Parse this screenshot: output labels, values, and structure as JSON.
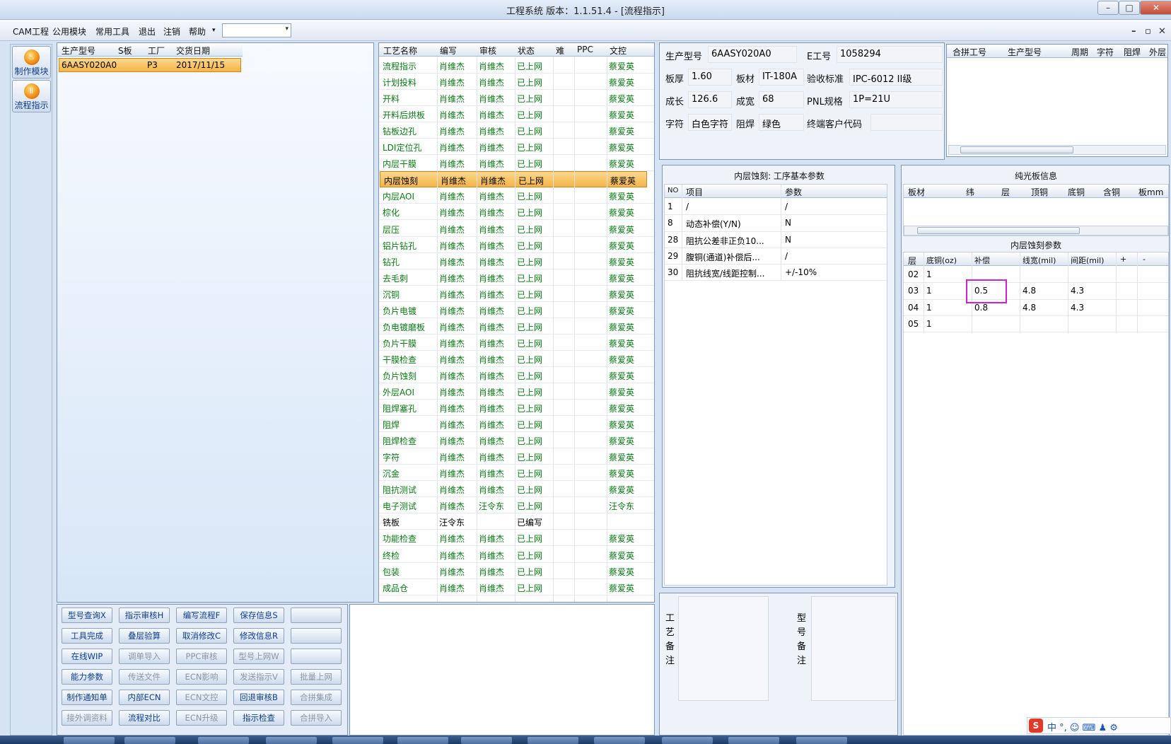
{
  "window": {
    "title": "工程系统  版本：1.1.51.4 - [流程指示]",
    "min": "–",
    "max": "□",
    "close": "✕"
  },
  "menu": {
    "items": [
      "CAM工程",
      "公用模块",
      "常用工具",
      "退出",
      "注销",
      "帮助"
    ],
    "help_arrow": "▾",
    "combo_arrow": "▾",
    "mdi": [
      "–",
      "▫",
      "✕"
    ]
  },
  "sidebar": {
    "buttons": [
      {
        "label": "制作模块",
        "icon": "flame-icon"
      },
      {
        "label": "流程指示",
        "icon": "pause-icon"
      }
    ]
  },
  "orders": {
    "columns": [
      "生产型号",
      "S板",
      "工厂",
      "交货日期"
    ],
    "rows": [
      {
        "model": "6AASY020A0",
        "s": "",
        "factory": "P3",
        "date": "2017/11/15"
      }
    ]
  },
  "process": {
    "columns": [
      "工艺名称",
      "编写",
      "审核",
      "状态",
      "难",
      "PPC",
      "文控"
    ],
    "rows": [
      [
        "流程指示",
        "肖维杰",
        "肖维杰",
        "已上网",
        "",
        "",
        "蔡爱英"
      ],
      [
        "计划投料",
        "肖维杰",
        "肖维杰",
        "已上网",
        "",
        "",
        "蔡爱英"
      ],
      [
        "开料",
        "肖维杰",
        "肖维杰",
        "已上网",
        "",
        "",
        "蔡爱英"
      ],
      [
        "开料后烘板",
        "肖维杰",
        "肖维杰",
        "已上网",
        "",
        "",
        "蔡爱英"
      ],
      [
        "钻板边孔",
        "肖维杰",
        "肖维杰",
        "已上网",
        "",
        "",
        "蔡爱英"
      ],
      [
        "LDI定位孔",
        "肖维杰",
        "肖维杰",
        "已上网",
        "",
        "",
        "蔡爱英"
      ],
      [
        "内层干膜",
        "肖维杰",
        "肖维杰",
        "已上网",
        "",
        "",
        "蔡爱英"
      ],
      [
        "内层蚀刻",
        "肖维杰",
        "肖维杰",
        "已上网",
        "",
        "",
        "蔡爱英"
      ],
      [
        "内层AOI",
        "肖维杰",
        "肖维杰",
        "已上网",
        "",
        "",
        "蔡爱英"
      ],
      [
        "棕化",
        "肖维杰",
        "肖维杰",
        "已上网",
        "",
        "",
        "蔡爱英"
      ],
      [
        "层压",
        "肖维杰",
        "肖维杰",
        "已上网",
        "",
        "",
        "蔡爱英"
      ],
      [
        "铝片钻孔",
        "肖维杰",
        "肖维杰",
        "已上网",
        "",
        "",
        "蔡爱英"
      ],
      [
        "钻孔",
        "肖维杰",
        "肖维杰",
        "已上网",
        "",
        "",
        "蔡爱英"
      ],
      [
        "去毛刺",
        "肖维杰",
        "肖维杰",
        "已上网",
        "",
        "",
        "蔡爱英"
      ],
      [
        "沉铜",
        "肖维杰",
        "肖维杰",
        "已上网",
        "",
        "",
        "蔡爱英"
      ],
      [
        "负片电镀",
        "肖维杰",
        "肖维杰",
        "已上网",
        "",
        "",
        "蔡爱英"
      ],
      [
        "负电镀磨板",
        "肖维杰",
        "肖维杰",
        "已上网",
        "",
        "",
        "蔡爱英"
      ],
      [
        "负片干膜",
        "肖维杰",
        "肖维杰",
        "已上网",
        "",
        "",
        "蔡爱英"
      ],
      [
        "干膜检查",
        "肖维杰",
        "肖维杰",
        "已上网",
        "",
        "",
        "蔡爱英"
      ],
      [
        "负片蚀刻",
        "肖维杰",
        "肖维杰",
        "已上网",
        "",
        "",
        "蔡爱英"
      ],
      [
        "外层AOI",
        "肖维杰",
        "肖维杰",
        "已上网",
        "",
        "",
        "蔡爱英"
      ],
      [
        "阻焊塞孔",
        "肖维杰",
        "肖维杰",
        "已上网",
        "",
        "",
        "蔡爱英"
      ],
      [
        "阻焊",
        "肖维杰",
        "肖维杰",
        "已上网",
        "",
        "",
        "蔡爱英"
      ],
      [
        "阻焊检查",
        "肖维杰",
        "肖维杰",
        "已上网",
        "",
        "",
        "蔡爱英"
      ],
      [
        "字符",
        "肖维杰",
        "肖维杰",
        "已上网",
        "",
        "",
        "蔡爱英"
      ],
      [
        "沉金",
        "肖维杰",
        "肖维杰",
        "已上网",
        "",
        "",
        "蔡爱英"
      ],
      [
        "阻抗测试",
        "肖维杰",
        "肖维杰",
        "已上网",
        "",
        "",
        "蔡爱英"
      ],
      [
        "电子测试",
        "肖维杰",
        "汪令东",
        "已上网",
        "",
        "",
        "汪令东"
      ],
      [
        "铣板",
        "汪令东",
        "",
        "已编写",
        "",
        "",
        ""
      ],
      [
        "功能检查",
        "肖维杰",
        "肖维杰",
        "已上网",
        "",
        "",
        "蔡爱英"
      ],
      [
        "终检",
        "肖维杰",
        "肖维杰",
        "已上网",
        "",
        "",
        "蔡爱英"
      ],
      [
        "包装",
        "肖维杰",
        "肖维杰",
        "已上网",
        "",
        "",
        "蔡爱英"
      ],
      [
        "成品仓",
        "肖维杰",
        "肖维杰",
        "已上网",
        "",
        "",
        "蔡爱英"
      ]
    ],
    "selected_index": 7
  },
  "info": {
    "model_label": "生产型号",
    "model": "6AASY020A0",
    "eno_label": "E工号",
    "eno": "1058294",
    "thick_label": "板厚",
    "thick": "1.60",
    "material_label": "板材",
    "material": "IT-180A",
    "std_label": "验收标准",
    "std": "IPC-6012 II级",
    "len_label": "成长",
    "len": "126.6",
    "wid_label": "成宽",
    "wid": "68",
    "pnl_label": "PNL规格",
    "pnl": "1P=21U",
    "char_label": "字符",
    "char": "白色字符",
    "mask_label": "阻焊",
    "mask": "绿色",
    "cust_label": "终端客户代码",
    "cust": ""
  },
  "merge": {
    "columns": [
      "合拼工号",
      "生产型号",
      "周期",
      "字符",
      "阻焊",
      "外层"
    ]
  },
  "basic_params": {
    "title": "内层蚀刻: 工序基本参数",
    "columns": [
      "NO",
      "项目",
      "参数"
    ],
    "rows": [
      [
        "1",
        "/",
        "/"
      ],
      [
        "8",
        "动态补偿(Y/N)",
        "N"
      ],
      [
        "28",
        "阻抗公差非正负10...",
        "N"
      ],
      [
        "29",
        "腹铜(通道)补偿后...",
        "/"
      ],
      [
        "30",
        "阻抗线宽/线距控制...",
        "+/-10%"
      ]
    ]
  },
  "pure_board": {
    "title": "纯光板信息",
    "columns": [
      "板材",
      "纬",
      "层",
      "顶铜",
      "底铜",
      "含铜",
      "板mm"
    ]
  },
  "etch_params": {
    "title": "内层蚀刻参数",
    "columns": [
      "层",
      "底铜(oz)",
      "补偿",
      "线宽(mil)",
      "间距(mil)",
      "+",
      "-"
    ],
    "rows": [
      [
        "02",
        "1",
        "",
        "",
        ""
      ],
      [
        "03",
        "1",
        "0.5",
        "4.8",
        "4.3"
      ],
      [
        "04",
        "1",
        "0.8",
        "4.8",
        "4.3"
      ],
      [
        "05",
        "1",
        "",
        "",
        ""
      ]
    ]
  },
  "remarks": {
    "process_label": "工艺备注",
    "model_label": "型号备注"
  },
  "buttons": [
    [
      {
        "t": "型号查询X",
        "d": false
      },
      {
        "t": "指示审核H",
        "d": false
      },
      {
        "t": "编写流程F",
        "d": false
      },
      {
        "t": "保存信息S",
        "d": false
      },
      {
        "t": "",
        "d": false
      }
    ],
    [
      {
        "t": "工具完成",
        "d": false
      },
      {
        "t": "叠层验算",
        "d": false
      },
      {
        "t": "取消修改C",
        "d": false
      },
      {
        "t": "修改信息R",
        "d": false
      },
      {
        "t": "",
        "d": false
      }
    ],
    [
      {
        "t": "在线WIP",
        "d": false
      },
      {
        "t": "调单导入",
        "d": true
      },
      {
        "t": "PPC审核",
        "d": true
      },
      {
        "t": "型号上网W",
        "d": true
      },
      {
        "t": "",
        "d": false
      }
    ],
    [
      {
        "t": "能力参数",
        "d": false
      },
      {
        "t": "传送文件",
        "d": true
      },
      {
        "t": "ECN影响",
        "d": true
      },
      {
        "t": "发送指示V",
        "d": true
      },
      {
        "t": "批量上网",
        "d": true
      }
    ],
    [
      {
        "t": "制作通知单",
        "d": false
      },
      {
        "t": "内部ECN",
        "d": false
      },
      {
        "t": "ECN文控",
        "d": true
      },
      {
        "t": "回退审核B",
        "d": false
      },
      {
        "t": "合拼集成",
        "d": true
      }
    ],
    [
      {
        "t": "接外调资料",
        "d": true
      },
      {
        "t": "流程对比",
        "d": false
      },
      {
        "t": "ECN升级",
        "d": true
      },
      {
        "t": "指示检查",
        "d": false
      },
      {
        "t": "合拼导入",
        "d": true
      }
    ]
  ],
  "ime": {
    "logo": "S",
    "text": "中 °, ☺ ⌨ ♟ ⚙"
  },
  "colors": {
    "accent_sel": "#f4b447",
    "green_text": "#0b7a16",
    "highlight_box": "#d020d6",
    "bg": "#d6e3f3"
  }
}
